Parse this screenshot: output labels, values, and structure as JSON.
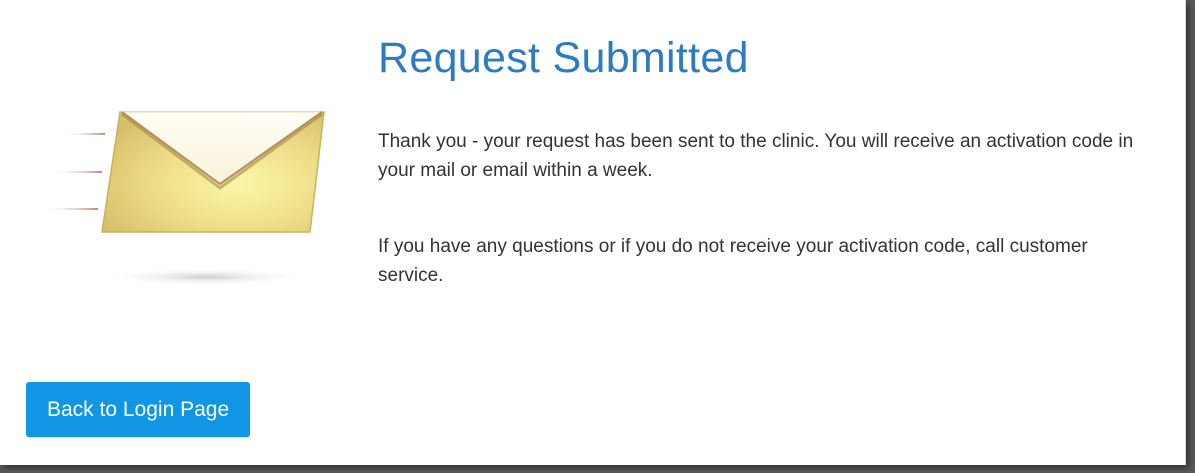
{
  "dialog": {
    "title": "Request Submitted",
    "message_1": "Thank you - your request has been sent to the clinic. You will receive an activation code in your mail or email within a week.",
    "message_2": "If you have any questions or if you do not receive your activation code, call customer service."
  },
  "actions": {
    "back_label": "Back to Login Page"
  },
  "illustration": {
    "icon": "flying-envelope-icon"
  },
  "colors": {
    "title": "#2d7cc1",
    "button_bg": "#1196e6",
    "button_text": "#ffffff",
    "body_text": "#333333",
    "envelope": "#f2e68c"
  }
}
